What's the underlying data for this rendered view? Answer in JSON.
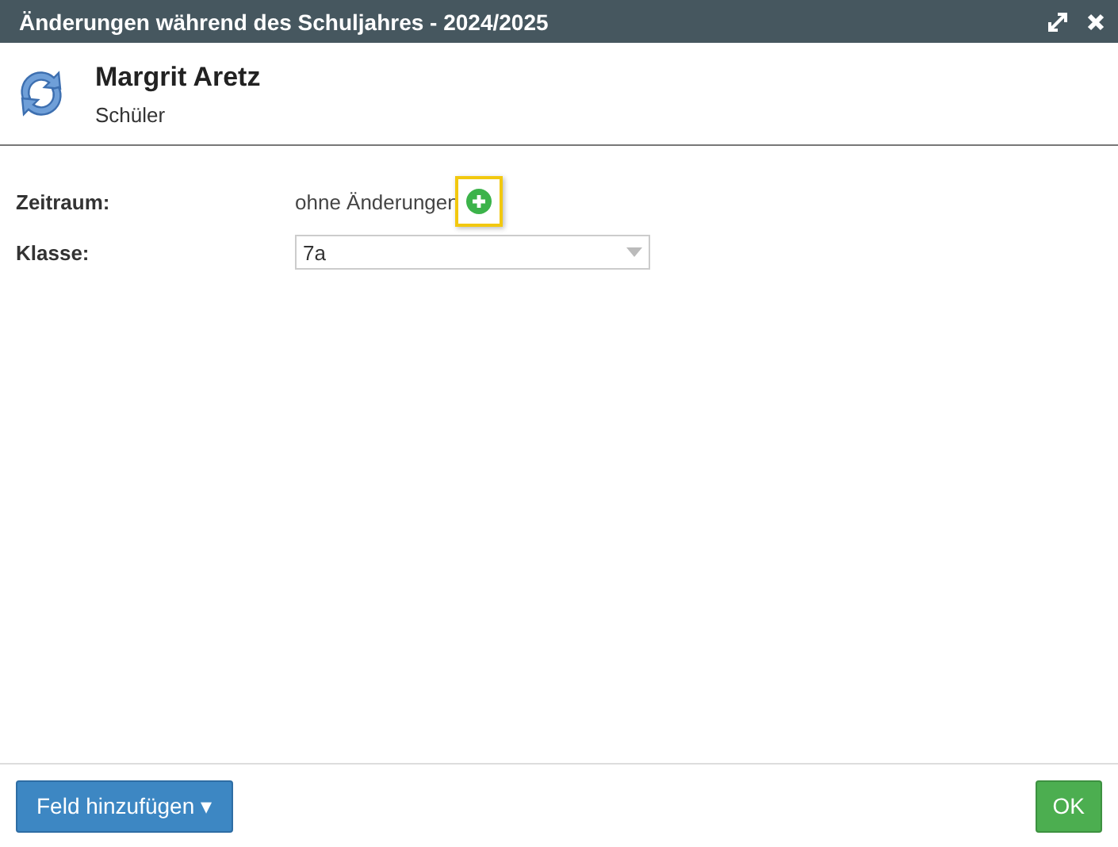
{
  "window": {
    "title": "Änderungen während des Schuljahres - 2024/2025"
  },
  "person": {
    "name": "Margrit Aretz",
    "role": "Schüler"
  },
  "fields": [
    {
      "kind": "text",
      "label": "Zeitraum:",
      "value": "ohne Änderungen",
      "add_highlighted": true
    },
    {
      "kind": "select",
      "label": "Klasse:",
      "value": "7a"
    }
  ],
  "footer": {
    "add_button": {
      "label": "Feld hinzufügen",
      "caret": "▾"
    },
    "ok_button": "OK"
  }
}
